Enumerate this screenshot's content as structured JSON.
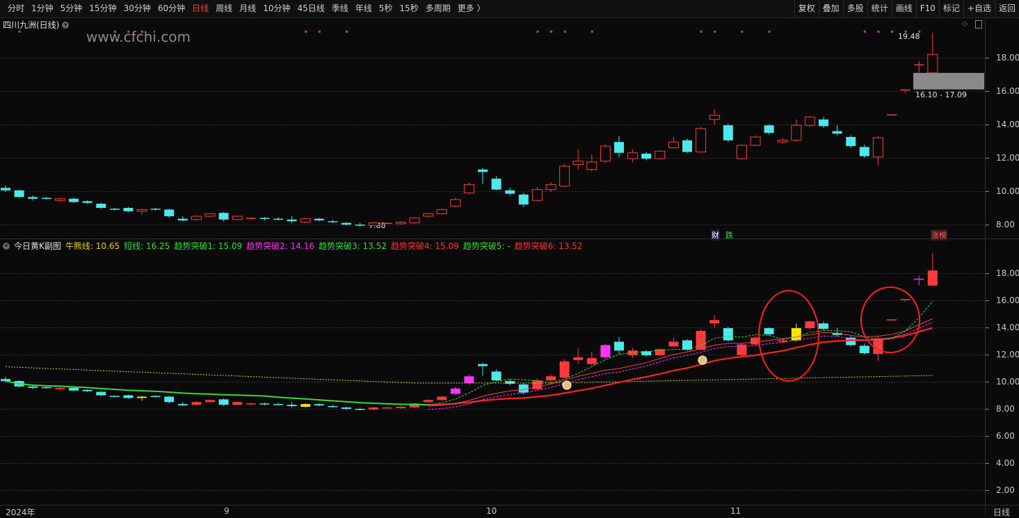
{
  "toolbar": {
    "periods": [
      "分时",
      "1分钟",
      "5分钟",
      "15分钟",
      "30分钟",
      "60分钟",
      "日线",
      "周线",
      "月线",
      "10分钟",
      "45日线",
      "季线",
      "年线",
      "5秒",
      "15秒",
      "多周期",
      "更多 〉"
    ],
    "active_period": "日线",
    "tools": [
      "复权",
      "叠加",
      "多股",
      "统计",
      "画线",
      "F10",
      "标记",
      "+自选",
      "返回"
    ]
  },
  "main_panel": {
    "title": "四川九洲(日线)",
    "watermark": "www.cfchi.com",
    "y_ticks": [
      "18.00",
      "16.00",
      "14.00",
      "12.00",
      "10.00",
      "8.00"
    ],
    "annotations": {
      "high_label": "19.48",
      "range_label": "16.10 - 17.09",
      "low_label": "7.88"
    },
    "event_tags": {
      "cai": "财",
      "die": "跌",
      "zhangbang": "涨榜"
    }
  },
  "sub_panel": {
    "title": "今日黄K副图",
    "indicators": [
      {
        "label": "牛熊线: 10.65",
        "color": "#e6d000"
      },
      {
        "label": "短线: 16.25",
        "color": "#33dd33"
      },
      {
        "label": "趋势突破1: 15.09",
        "color": "#33dd33"
      },
      {
        "label": "趋势突破2: 14.16",
        "color": "#ff33ff"
      },
      {
        "label": "趋势突破3: 13.52",
        "color": "#33dd33"
      },
      {
        "label": "趋势突破4: 15.09",
        "color": "#ff3333"
      },
      {
        "label": "趋势突破5: -",
        "color": "#33dd33"
      },
      {
        "label": "趋势突破6: 13.52",
        "color": "#ff3333"
      }
    ],
    "y_ticks": [
      "18.00",
      "16.00",
      "14.00",
      "12.00",
      "10.00",
      "8.00",
      "6.00",
      "4.00",
      "2.00"
    ]
  },
  "x_axis": {
    "labels": [
      "2024年",
      "9",
      "10",
      "11"
    ],
    "period_label": "日线"
  },
  "colors": {
    "up": "#ff3b3b",
    "down": "#4de8ec",
    "yellow": "#f5e600",
    "magenta": "#ff33ff"
  },
  "chart_data": {
    "type": "candlestick",
    "title": "四川九洲(日线)",
    "ylim": [
      7.5,
      20.0
    ],
    "candles": [
      {
        "o": 10.2,
        "h": 10.35,
        "l": 9.95,
        "c": 10.05
      },
      {
        "o": 10.05,
        "h": 10.1,
        "l": 9.6,
        "c": 9.65
      },
      {
        "o": 9.65,
        "h": 9.75,
        "l": 9.45,
        "c": 9.55
      },
      {
        "o": 9.6,
        "h": 9.65,
        "l": 9.5,
        "c": 9.55
      },
      {
        "o": 9.45,
        "h": 9.6,
        "l": 9.35,
        "c": 9.55
      },
      {
        "o": 9.55,
        "h": 9.6,
        "l": 9.3,
        "c": 9.35
      },
      {
        "o": 9.4,
        "h": 9.45,
        "l": 9.25,
        "c": 9.3
      },
      {
        "o": 9.25,
        "h": 9.3,
        "l": 8.95,
        "c": 9.0
      },
      {
        "o": 8.95,
        "h": 9.0,
        "l": 8.85,
        "c": 8.9
      },
      {
        "o": 9.0,
        "h": 9.05,
        "l": 8.75,
        "c": 8.8
      },
      {
        "o": 8.8,
        "h": 8.95,
        "l": 8.6,
        "c": 8.9
      },
      {
        "o": 8.95,
        "h": 9.0,
        "l": 8.85,
        "c": 8.9
      },
      {
        "o": 8.9,
        "h": 8.95,
        "l": 8.4,
        "c": 8.5
      },
      {
        "o": 8.35,
        "h": 8.5,
        "l": 8.2,
        "c": 8.25
      },
      {
        "o": 8.3,
        "h": 8.55,
        "l": 8.25,
        "c": 8.5
      },
      {
        "o": 8.5,
        "h": 8.7,
        "l": 8.45,
        "c": 8.65
      },
      {
        "o": 8.7,
        "h": 8.75,
        "l": 8.2,
        "c": 8.3
      },
      {
        "o": 8.3,
        "h": 8.55,
        "l": 8.25,
        "c": 8.5
      },
      {
        "o": 8.35,
        "h": 8.45,
        "l": 8.3,
        "c": 8.4
      },
      {
        "o": 8.4,
        "h": 8.45,
        "l": 8.25,
        "c": 8.35
      },
      {
        "o": 8.35,
        "h": 8.45,
        "l": 8.25,
        "c": 8.3
      },
      {
        "o": 8.3,
        "h": 8.5,
        "l": 8.1,
        "c": 8.2
      },
      {
        "o": 8.15,
        "h": 8.4,
        "l": 8.1,
        "c": 8.35
      },
      {
        "o": 8.35,
        "h": 8.4,
        "l": 8.2,
        "c": 8.25
      },
      {
        "o": 8.2,
        "h": 8.3,
        "l": 8.1,
        "c": 8.15
      },
      {
        "o": 8.1,
        "h": 8.15,
        "l": 7.95,
        "c": 8.0
      },
      {
        "o": 8.0,
        "h": 8.1,
        "l": 7.88,
        "c": 7.95
      },
      {
        "o": 7.95,
        "h": 8.15,
        "l": 7.9,
        "c": 8.1
      },
      {
        "o": 8.1,
        "h": 8.15,
        "l": 8.05,
        "c": 8.1
      },
      {
        "o": 8.05,
        "h": 8.2,
        "l": 8.0,
        "c": 8.15
      },
      {
        "o": 8.1,
        "h": 8.45,
        "l": 8.05,
        "c": 8.4
      },
      {
        "o": 8.5,
        "h": 8.7,
        "l": 8.45,
        "c": 8.65
      },
      {
        "o": 8.65,
        "h": 8.95,
        "l": 8.6,
        "c": 8.9
      },
      {
        "o": 9.1,
        "h": 9.6,
        "l": 9.05,
        "c": 9.5
      },
      {
        "o": 9.9,
        "h": 10.5,
        "l": 9.8,
        "c": 10.4
      },
      {
        "o": 11.3,
        "h": 11.4,
        "l": 10.45,
        "c": 11.15
      },
      {
        "o": 10.75,
        "h": 10.9,
        "l": 10.05,
        "c": 10.1
      },
      {
        "o": 10.05,
        "h": 10.2,
        "l": 9.75,
        "c": 9.85
      },
      {
        "o": 9.8,
        "h": 9.9,
        "l": 9.05,
        "c": 9.2
      },
      {
        "o": 9.45,
        "h": 10.25,
        "l": 9.4,
        "c": 10.1
      },
      {
        "o": 10.1,
        "h": 10.55,
        "l": 9.95,
        "c": 10.4
      },
      {
        "o": 10.3,
        "h": 11.65,
        "l": 10.25,
        "c": 11.5
      },
      {
        "o": 11.6,
        "h": 12.5,
        "l": 11.3,
        "c": 11.8
      },
      {
        "o": 11.3,
        "h": 12.2,
        "l": 11.2,
        "c": 11.75
      },
      {
        "o": 11.8,
        "h": 12.8,
        "l": 11.7,
        "c": 12.7
      },
      {
        "o": 12.95,
        "h": 13.3,
        "l": 12.05,
        "c": 12.3
      },
      {
        "o": 11.95,
        "h": 12.5,
        "l": 11.75,
        "c": 12.3
      },
      {
        "o": 12.25,
        "h": 12.35,
        "l": 11.85,
        "c": 11.95
      },
      {
        "o": 11.95,
        "h": 12.45,
        "l": 11.9,
        "c": 12.4
      },
      {
        "o": 12.6,
        "h": 13.25,
        "l": 12.55,
        "c": 12.95
      },
      {
        "o": 13.05,
        "h": 13.15,
        "l": 12.3,
        "c": 12.35
      },
      {
        "o": 12.35,
        "h": 13.85,
        "l": 12.3,
        "c": 13.75
      },
      {
        "o": 14.3,
        "h": 14.9,
        "l": 14.0,
        "c": 14.55
      },
      {
        "o": 13.95,
        "h": 14.05,
        "l": 12.95,
        "c": 13.05
      },
      {
        "o": 11.95,
        "h": 12.8,
        "l": 11.9,
        "c": 12.75
      },
      {
        "o": 12.75,
        "h": 13.35,
        "l": 12.7,
        "c": 13.25
      },
      {
        "o": 13.95,
        "h": 14.0,
        "l": 13.4,
        "c": 13.5
      },
      {
        "o": 12.95,
        "h": 13.2,
        "l": 12.85,
        "c": 13.05
      },
      {
        "o": 13.05,
        "h": 14.3,
        "l": 12.95,
        "c": 13.95
      },
      {
        "o": 13.95,
        "h": 14.5,
        "l": 13.85,
        "c": 14.45
      },
      {
        "o": 14.3,
        "h": 14.45,
        "l": 13.8,
        "c": 13.9
      },
      {
        "o": 13.6,
        "h": 13.95,
        "l": 13.35,
        "c": 13.45
      },
      {
        "o": 13.25,
        "h": 13.35,
        "l": 12.6,
        "c": 12.7
      },
      {
        "o": 12.65,
        "h": 12.8,
        "l": 12.0,
        "c": 12.1
      },
      {
        "o": 12.05,
        "h": 13.3,
        "l": 11.55,
        "c": 13.2
      },
      {
        "o": 14.6,
        "h": 14.6,
        "l": 14.6,
        "c": 14.6
      },
      {
        "o": 16.1,
        "h": 16.1,
        "l": 15.9,
        "c": 16.1
      },
      {
        "o": 17.6,
        "h": 17.8,
        "l": 17.1,
        "c": 17.6
      },
      {
        "o": 17.09,
        "h": 19.48,
        "l": 17.09,
        "c": 18.2
      }
    ]
  }
}
